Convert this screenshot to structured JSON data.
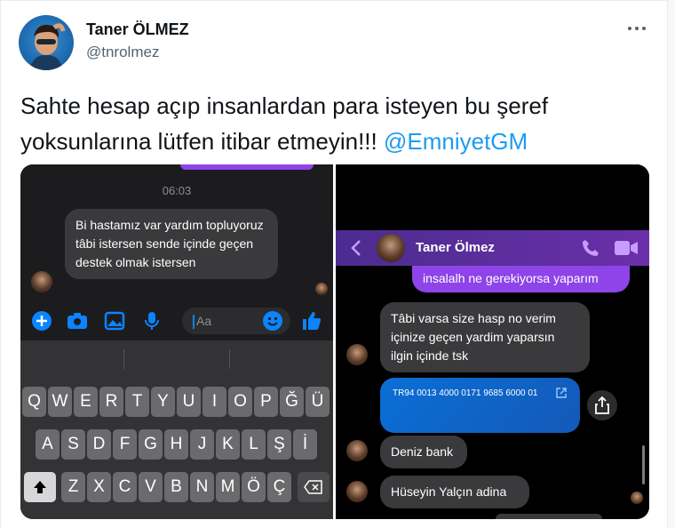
{
  "tweet": {
    "author_name": "Taner ÖLMEZ",
    "author_handle": "@tnrolmez",
    "text_main": "Sahte hesap açıp insanlardan para isteyen bu şeref yoksunlarına lütfen itibar etmeyin!!! ",
    "mention": "@EmniyetGM"
  },
  "left_screenshot": {
    "timestamp": "06:03",
    "message": "Bi hastamız var yardım topluyoruz tâbi istersen sende içinde geçen destek olmak istersen",
    "composer_placeholder": "Aa",
    "keyboard_rows": [
      [
        "Q",
        "W",
        "E",
        "R",
        "T",
        "Y",
        "U",
        "I",
        "O",
        "P",
        "Ğ",
        "Ü"
      ],
      [
        "A",
        "S",
        "D",
        "F",
        "G",
        "H",
        "J",
        "K",
        "L",
        "Ş",
        "İ"
      ],
      [
        "Z",
        "X",
        "C",
        "V",
        "B",
        "N",
        "M",
        "Ö",
        "Ç"
      ]
    ]
  },
  "right_screenshot": {
    "contact_name": "Taner Ölmez",
    "sent_message": "insalalh ne gerekiyorsa yaparım",
    "msg1": "Tâbi varsa size hasp no verim içinize geçen yardim yaparsın ilgin içinde tsk",
    "iban": "TR94 0013 4000 0171 9685 6000 01",
    "msg2": "Deniz bank",
    "msg3": "Hüseyin Yalçın adina"
  },
  "colors": {
    "link": "#1d9bf0",
    "messenger_purple": "#8e44e8",
    "messenger_blue": "#0a84ff"
  }
}
